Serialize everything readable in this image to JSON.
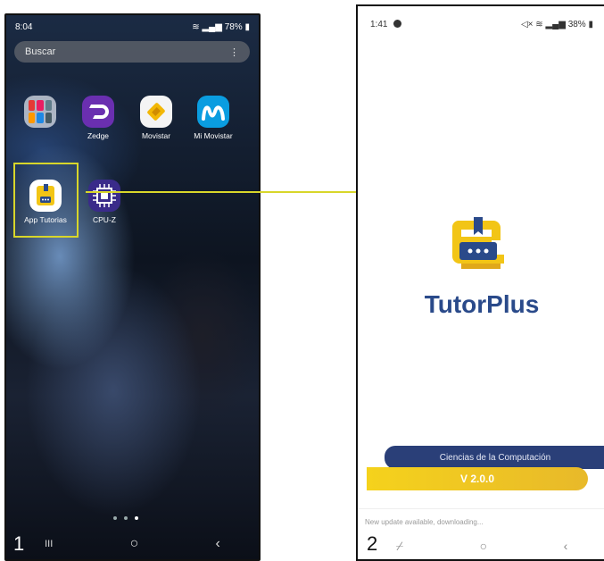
{
  "phone1": {
    "status": {
      "time": "8:04",
      "battery": "78%"
    },
    "search": {
      "placeholder": "Buscar",
      "menu": "⋮"
    },
    "apps": [
      {
        "label": ""
      },
      {
        "label": "Zedge"
      },
      {
        "label": "Movistar"
      },
      {
        "label": "Mi Movistar"
      },
      {
        "label": "App Tutorias"
      },
      {
        "label": "CPU-Z"
      }
    ],
    "step": "1",
    "nav": {
      "recents": "III",
      "home": "○",
      "back": "‹"
    }
  },
  "phone2": {
    "status": {
      "time": "1:41",
      "battery": "38%"
    },
    "brand": "TutorPlus",
    "banner": "Ciencias de la Computación",
    "version": "V 2.0.0",
    "update_message": "New update available, downloading...",
    "step": "2",
    "nav": {
      "recents": "⌿",
      "home": "○",
      "back": "‹"
    }
  },
  "colors": {
    "highlight": "#d8d62a",
    "brand": "#2a4a8a",
    "banner_blue": "#2a3f78",
    "banner_yellow": "#f5d21c"
  }
}
